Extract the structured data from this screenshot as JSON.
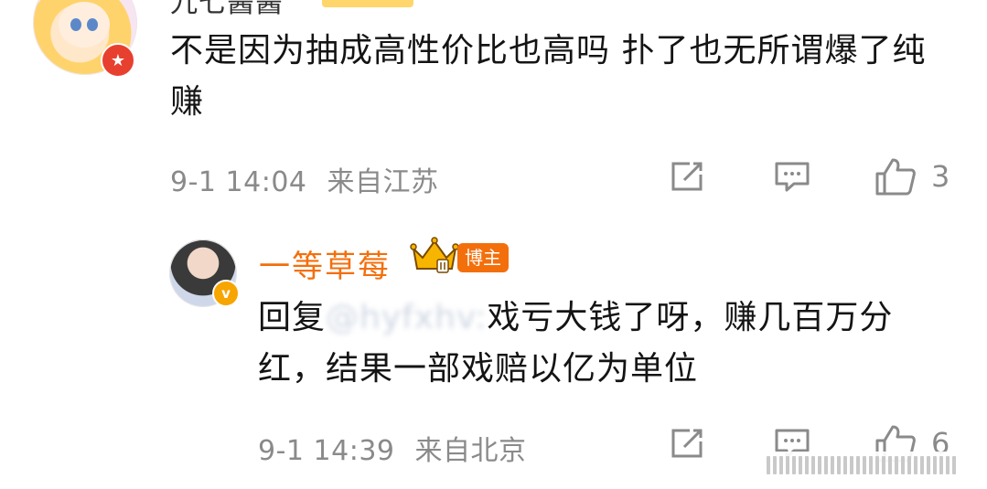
{
  "comment1": {
    "username": "九七酱酱",
    "content": "不是因为抽成高性价比也高吗 扑了也无所谓爆了纯赚",
    "timestamp": "9-1 14:04",
    "location": "来自江苏",
    "like_count": "3"
  },
  "reply": {
    "username": "一等草莓",
    "author_badge": "博主",
    "reply_prefix": "回复",
    "mention": "@hyfxhv:",
    "content": "戏亏大钱了呀，赚几百万分红，结果一部戏赔以亿为单位",
    "timestamp": "9-1 14:39",
    "location": "来自北京",
    "like_count": "6"
  },
  "icons": {
    "repost": "repost-icon",
    "comment": "comment-icon",
    "like": "thumbs-up-icon",
    "crown": "crown-icon"
  },
  "colors": {
    "author_name": "#f36f0c",
    "meta_text": "#8a8a8a",
    "badge_red": "#e8402f",
    "badge_orange": "#f7a500"
  }
}
